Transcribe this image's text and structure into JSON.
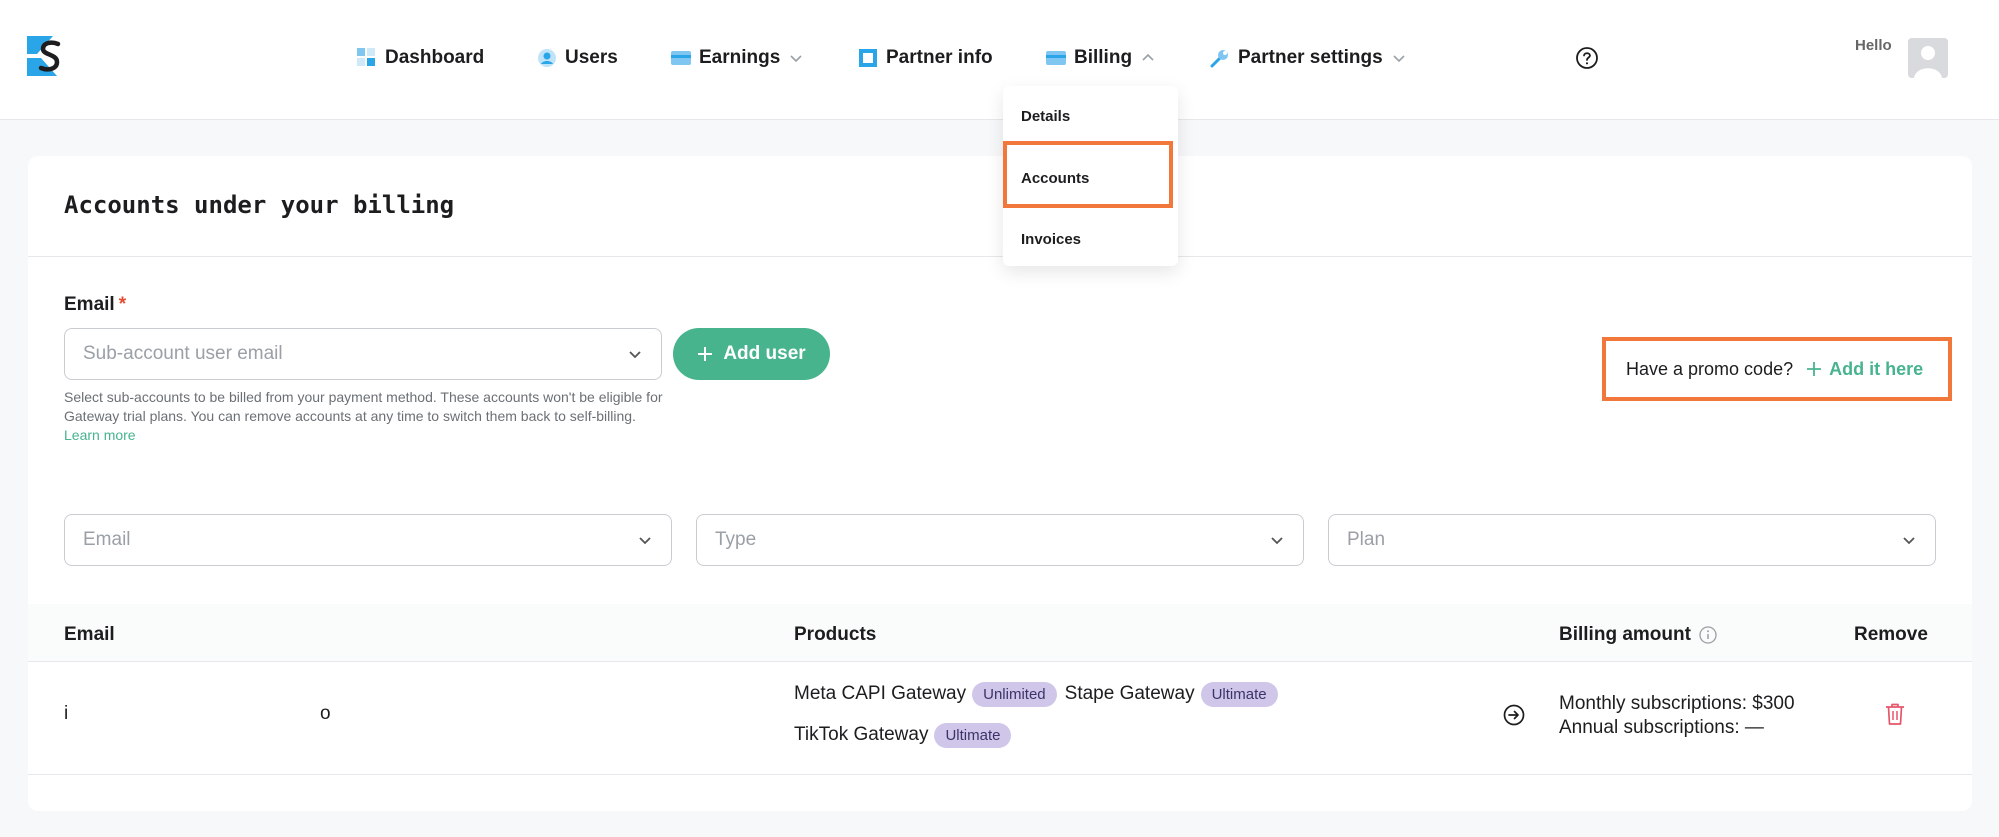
{
  "nav": {
    "items": [
      {
        "label": "Dashboard",
        "icon": "dashboard-icon"
      },
      {
        "label": "Users",
        "icon": "user-icon"
      },
      {
        "label": "Earnings",
        "icon": "card-icon",
        "dropdown": true
      },
      {
        "label": "Partner info",
        "icon": "square-icon"
      },
      {
        "label": "Billing",
        "icon": "card-icon",
        "dropdown": true,
        "open": true
      },
      {
        "label": "Partner settings",
        "icon": "wrench-icon",
        "dropdown": true
      }
    ],
    "hello": "Hello"
  },
  "billing_menu": {
    "items": [
      "Details",
      "Accounts",
      "Invoices"
    ]
  },
  "page": {
    "title": "Accounts under your billing",
    "email_label": "Email",
    "email_required": "*",
    "email_placeholder": "Sub-account user email",
    "add_user_label": "Add user",
    "helper_text": "Select sub-accounts to be billed from your payment method. These accounts won't be eligible for Gateway trial plans. You can remove accounts at any time to switch them back to self-billing.",
    "learn_more": "Learn more",
    "promo_text": "Have a promo code?",
    "promo_link": "Add it here"
  },
  "filters": {
    "email": "Email",
    "type": "Type",
    "plan": "Plan"
  },
  "table": {
    "headers": {
      "email": "Email",
      "products": "Products",
      "billing_amount": "Billing amount",
      "remove": "Remove"
    },
    "rows": [
      {
        "email_start": "i",
        "email_end": "o",
        "products": [
          {
            "name": "Meta CAPI Gateway",
            "plan": "Unlimited"
          },
          {
            "name": "Stape Gateway",
            "plan": "Ultimate"
          },
          {
            "name": "TikTok Gateway",
            "plan": "Ultimate"
          }
        ],
        "monthly": "Monthly subscriptions: $300",
        "annual": "Annual subscriptions: —"
      }
    ]
  },
  "colors": {
    "accent": "#47b48d",
    "highlight": "#f2773a",
    "badge": "#cfc6ea",
    "danger": "#e5566b"
  }
}
